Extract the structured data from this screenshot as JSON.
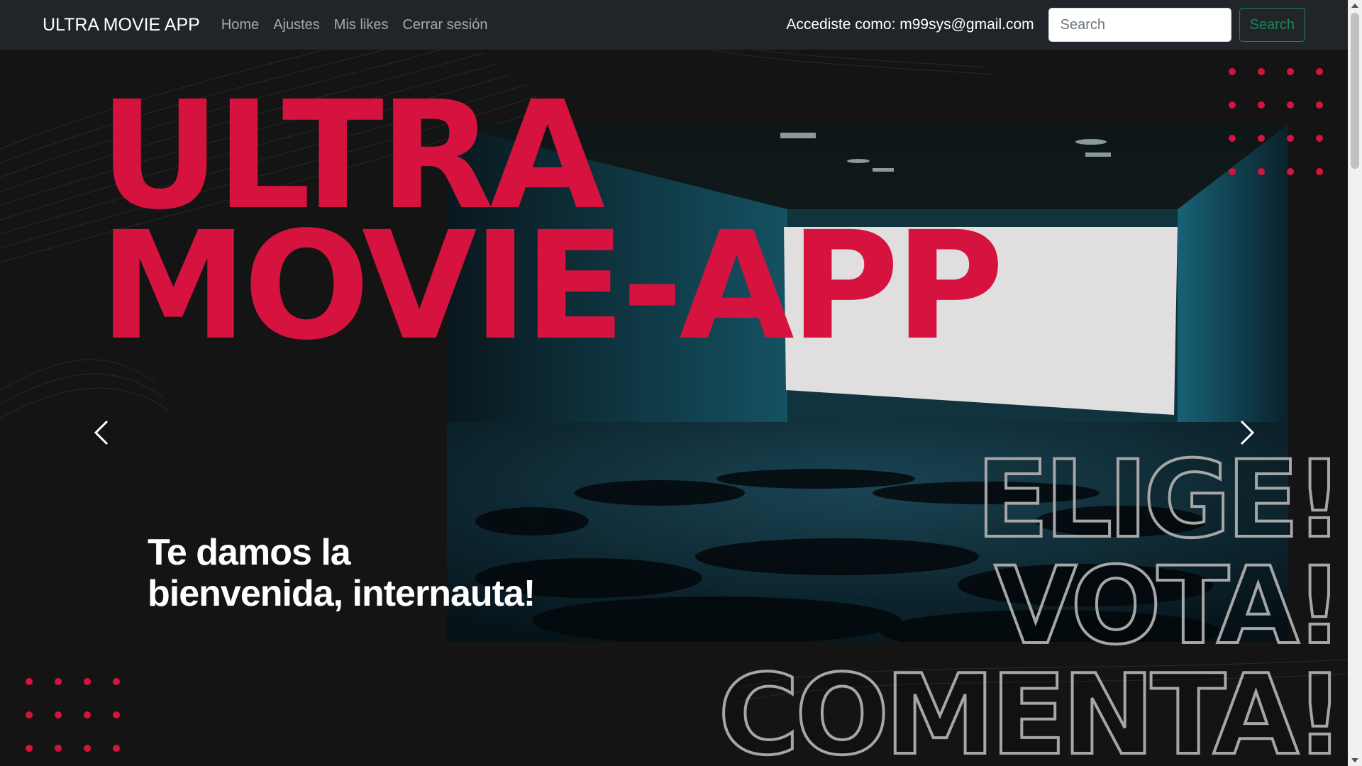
{
  "navbar": {
    "brand": "ULTRA MOVIE APP",
    "links": [
      "Home",
      "Ajustes",
      "Mis likes",
      "Cerrar sesión"
    ],
    "user_text": "Accediste como: m99sys@gmail.com",
    "search_placeholder": "Search",
    "search_button": "Search"
  },
  "hero": {
    "title_line1": "ULTRA",
    "title_line2": "MOVIE-APP",
    "welcome_line1": "Te damos la",
    "welcome_line2": "bienvenida, internauta!",
    "cta_line1": "ELIGE!",
    "cta_line2": "VOTA!",
    "cta_line3": "COMENTA!",
    "prev_icon": "chevron-left-icon",
    "next_icon": "chevron-right-icon"
  },
  "colors": {
    "accent": "#d6133f",
    "navbar_bg": "#212529",
    "success": "#198754",
    "hero_bg": "#141414"
  }
}
